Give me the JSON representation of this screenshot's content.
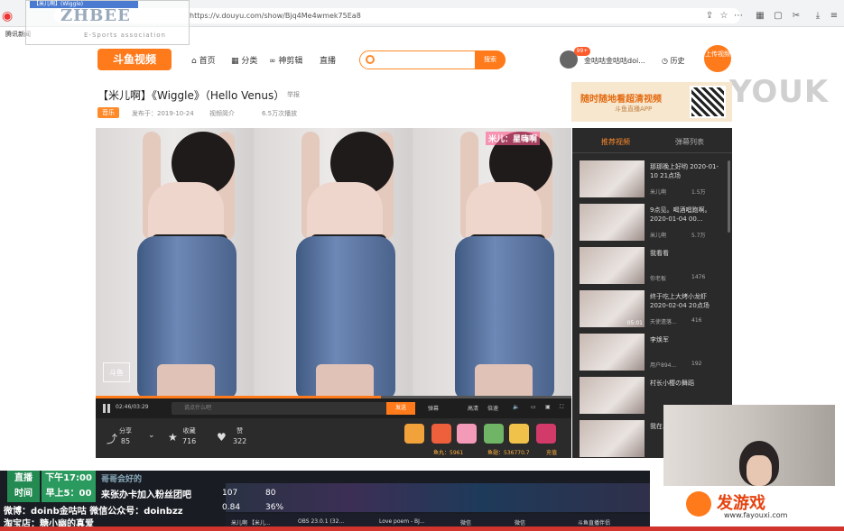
{
  "browser": {
    "url": "https://v.douyu.com/show/Bjq4Me4wmek75Ea8",
    "bookmark": "腾讯新闻",
    "overlay_tab": "【米儿啊】(Wiggle)"
  },
  "overlay": {
    "brand": "ZHBEE",
    "sub": "E-Sports association"
  },
  "site": {
    "logo": "斗鱼视频",
    "nav": [
      "首页",
      "分类",
      "神剪辑",
      "直播"
    ],
    "search_placeholder": "",
    "search_button": "搜索",
    "badge": "99+",
    "username": "金咕咕金咕咕doi...",
    "history": "历史",
    "upload": "上传视频"
  },
  "watermark": "YOUK",
  "video": {
    "title": "【米儿啊】《Wiggle》（Hello Venus）",
    "report": "举报",
    "tag": "音乐",
    "meta": [
      "发布于：2019-10-24",
      "视频简介",
      "6.5万次播放"
    ],
    "name_wm": "米儿：星嗨啊",
    "logo_wm": "斗鱼"
  },
  "ad": {
    "line1": "随时随地看超清视频",
    "line2": "斗鱼直播APP"
  },
  "controls": {
    "time": "02:46/03:29",
    "danmu_placeholder": "说点什么吧",
    "send": "发送",
    "options": [
      "弹幕",
      "高清",
      "倍速"
    ]
  },
  "actions": {
    "share": {
      "label": "分享",
      "count": "85"
    },
    "collect": {
      "label": "收藏",
      "count": "716"
    },
    "like": {
      "label": "赞",
      "count": "322"
    },
    "fish_ball": "鱼丸：5961",
    "fish_wing": "鱼翅：536770.7",
    "recharge": "充值"
  },
  "sidebar": {
    "tabs": [
      "推荐视频",
      "弹幕列表"
    ],
    "items": [
      {
        "title": "那那晚上好哟 2020-01-10 21点场",
        "author": "米儿啊",
        "plays": "1.5万",
        "duration": ""
      },
      {
        "title": "9点见。喝酒唱跑啊。2020-01-04 00...",
        "author": "米儿啊",
        "plays": "5.7万",
        "duration": ""
      },
      {
        "title": "我看看",
        "author": "你老板",
        "plays": "1476",
        "duration": ""
      },
      {
        "title": "终于吃上大烤小龙虾 2020-02-04 20点场",
        "author": "天使遗落...",
        "plays": "416",
        "duration": "05:01"
      },
      {
        "title": "李焕军",
        "author": "用户894...",
        "plays": "192",
        "duration": ""
      },
      {
        "title": "村长小樱の舞蹈",
        "author": "",
        "plays": "",
        "duration": ""
      },
      {
        "title": "我在斗鱼直播",
        "author": "",
        "plays": "",
        "duration": ""
      }
    ]
  },
  "stream_overlay": {
    "status_top": "直播",
    "status_bottom": "时间",
    "time_top": "下午17:00",
    "time_bottom": "早上5：00",
    "chat": "哥哥会好的",
    "line1": "来张办卡加入粉丝团吧",
    "line2": "微博：doinb金咕咕  微信公众号：doinbzz",
    "line3": "淘宝店：糖小幽的真爱",
    "stats": [
      "107",
      "80",
      "0.84",
      "36%"
    ]
  },
  "taskbar": [
    "米儿啊 【米儿...",
    "OBS 23.0.1 (32...",
    "Love poem - BJ...",
    "微信",
    "微信",
    "斗鱼直播伴侣"
  ],
  "fayou": {
    "name": "发游戏",
    "url": "www.fayouxi.com"
  }
}
